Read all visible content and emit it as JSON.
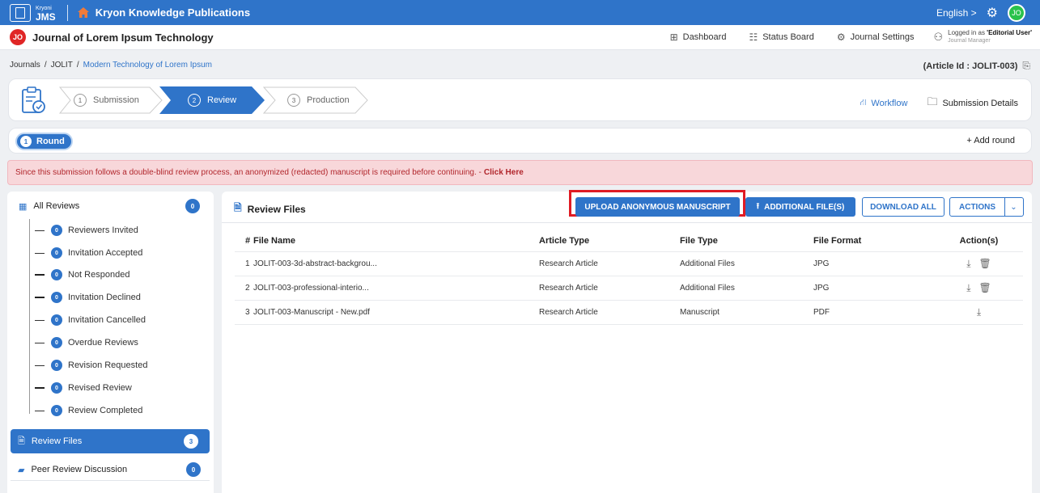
{
  "topbar": {
    "logo_small": "Kryoni",
    "logo_big": "JMS",
    "publisher": "Kryon Knowledge Publications",
    "language": "English >",
    "user_initials": "JO",
    "icons": [
      "home-icon",
      "gear-icon"
    ],
    "brand_color": "#2f74c9"
  },
  "journalbar": {
    "badge": "JO",
    "title": "Journal of Lorem Ipsum Technology",
    "nav": {
      "dashboard": "Dashboard",
      "status_board": "Status Board",
      "journal_settings": "Journal Settings"
    },
    "login_prefix": "Logged in as ",
    "login_role": "'Editorial User'",
    "login_sub": "Journal Manager"
  },
  "breadcrumb": {
    "journals": "Journals",
    "sep": "/",
    "code": "JOLIT",
    "current": "Modern Technology of Lorem Ipsum"
  },
  "article_id": "(Article Id : JOLIT-003)",
  "stepper": {
    "steps": [
      {
        "num": "1",
        "label": "Submission"
      },
      {
        "num": "2",
        "label": "Review"
      },
      {
        "num": "3",
        "label": "Production"
      }
    ],
    "workflow": "Workflow",
    "submission_details": "Submission Details"
  },
  "round": {
    "num": "1",
    "label": "Round",
    "add": "+ Add round"
  },
  "alert": {
    "text": "Since this submission follows a double-blind review process, an anonymized (redacted) manuscript is required before continuing. -",
    "link": "Click Here",
    "color": "#b1262c"
  },
  "sidebar": {
    "all_reviews": {
      "label": "All Reviews",
      "count": "0"
    },
    "sub_items": [
      {
        "label": "Reviewers Invited",
        "count": "0"
      },
      {
        "label": "Invitation Accepted",
        "count": "0"
      },
      {
        "label": "Not Responded",
        "count": "0"
      },
      {
        "label": "Invitation Declined",
        "count": "0"
      },
      {
        "label": "Invitation Cancelled",
        "count": "0"
      },
      {
        "label": "Overdue Reviews",
        "count": "0"
      },
      {
        "label": "Revision Requested",
        "count": "0"
      },
      {
        "label": "Revised Review",
        "count": "0"
      },
      {
        "label": "Review Completed",
        "count": "0"
      }
    ],
    "review_files": {
      "label": "Review Files",
      "count": "3"
    },
    "peer_review": {
      "label": "Peer Review Discussion",
      "count": "0"
    }
  },
  "panel": {
    "title": "Review Files",
    "buttons": {
      "upload_anon": "UPLOAD ANONYMOUS MANUSCRIPT",
      "additional": "ADDITIONAL FILE(S)",
      "download_all": "DOWNLOAD ALL",
      "actions": "ACTIONS"
    },
    "columns": [
      "#",
      "File Name",
      "Article Type",
      "File Type",
      "File Format",
      "Action(s)"
    ],
    "rows": [
      {
        "n": "1",
        "name": "JOLIT-003-3d-abstract-backgrou...",
        "article_type": "Research Article",
        "file_type": "Additional Files",
        "format": "JPG"
      },
      {
        "n": "2",
        "name": "JOLIT-003-professional-interio...",
        "article_type": "Research Article",
        "file_type": "Additional Files",
        "format": "JPG"
      },
      {
        "n": "3",
        "name": "JOLIT-003-Manuscript - New.pdf",
        "article_type": "Research Article",
        "file_type": "Manuscript",
        "format": "PDF"
      }
    ]
  }
}
